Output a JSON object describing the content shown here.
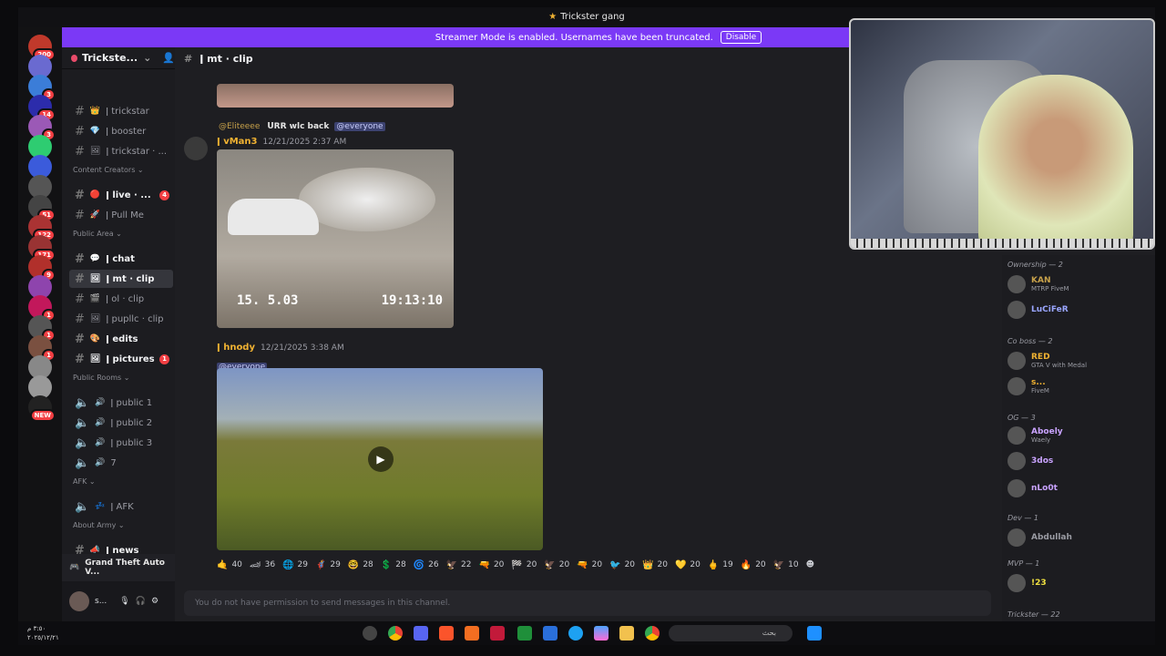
{
  "window": {
    "title": "Trickster gang"
  },
  "banner": {
    "text": "Streamer Mode is enabled. Usernames have been truncated.",
    "button": "Disable"
  },
  "servers": [
    {
      "badge": "200"
    },
    {
      "badge": ""
    },
    {
      "badge": "3"
    },
    {
      "badge": "14"
    },
    {
      "badge": "3"
    },
    {
      "badge": ""
    },
    {
      "badge": ""
    },
    {
      "badge": ""
    },
    {
      "badge": "51"
    },
    {
      "badge": "122"
    },
    {
      "badge": "171"
    },
    {
      "badge": "9"
    },
    {
      "badge": ""
    },
    {
      "badge": "1"
    },
    {
      "badge": "1"
    },
    {
      "badge": "1"
    },
    {
      "badge": ""
    },
    {
      "badge": ""
    },
    {
      "badge": "NEW"
    }
  ],
  "guild": {
    "name": "Trickste..."
  },
  "channels": {
    "items": [
      {
        "label": "ǀ trickstar"
      },
      {
        "label": "ǀ booster"
      },
      {
        "label": "ǀ trickstar · ..."
      },
      {
        "label": "ǀ live · ...",
        "unread": "4"
      },
      {
        "label": "ǀ Pull Me"
      },
      {
        "label": "ǀ chat"
      },
      {
        "label": "ǀ mt · clip"
      },
      {
        "label": "ǀ ol · clip"
      },
      {
        "label": "ǀ pupllc · clip"
      },
      {
        "label": "ǀ edits"
      },
      {
        "label": "ǀ pictures",
        "unread": "1"
      },
      {
        "label": "ǀ public 1"
      },
      {
        "label": "ǀ public 2"
      },
      {
        "label": "ǀ public 3"
      },
      {
        "label": "7"
      },
      {
        "label": "ǀ AFK"
      },
      {
        "label": "ǀ news"
      }
    ],
    "categories": [
      "Content Creators ⌄",
      "Public Area ⌄",
      "Public Rooms ⌄",
      "AFK ⌄",
      "About Army ⌄"
    ]
  },
  "voice": {
    "label": "Grand Theft Auto V..."
  },
  "user": {
    "name": "s..."
  },
  "header": {
    "channel": "ǀ mt · clip"
  },
  "messages": [
    {
      "reply_user": "@Eliteeee",
      "reply_text": "ᑌRR wlc back",
      "reply_mention": "@everyone",
      "author": "ǀ vMan3",
      "time": "12/21/2025 2:37 AM",
      "overlay_a": "15. 5.03",
      "overlay_b": "19:13:10"
    },
    {
      "author": "ǀ hnody",
      "time": "12/21/2025 3:38 AM",
      "mention": "@everyone"
    }
  ],
  "reactions": [
    {
      "icon": "🤙",
      "count": "40"
    },
    {
      "icon": "🏎",
      "count": "36"
    },
    {
      "icon": "🌐",
      "count": "29"
    },
    {
      "icon": "🦸",
      "count": "29"
    },
    {
      "icon": "🤓",
      "count": "28"
    },
    {
      "icon": "💲",
      "count": "28"
    },
    {
      "icon": "🌀",
      "count": "26"
    },
    {
      "icon": "🦅",
      "count": "22"
    },
    {
      "icon": "🔫",
      "count": "20"
    },
    {
      "icon": "🏁",
      "count": "20"
    },
    {
      "icon": "🦅",
      "count": "20"
    },
    {
      "icon": "🔫",
      "count": "20"
    },
    {
      "icon": "🐦",
      "count": "20"
    },
    {
      "icon": "👑",
      "count": "20"
    },
    {
      "icon": "💛",
      "count": "20"
    },
    {
      "icon": "🖕",
      "count": "19"
    },
    {
      "icon": "🔥",
      "count": "20"
    },
    {
      "icon": "🦅",
      "count": "10"
    }
  ],
  "composer": {
    "placeholder": "You do not have permission to send messages in this channel."
  },
  "members": {
    "groups": [
      {
        "label": "Ownership — 2"
      },
      {
        "label": "Co boss — 2"
      },
      {
        "label": "OG — 3"
      },
      {
        "label": "Dev — 1"
      },
      {
        "label": "MVP — 1"
      },
      {
        "label": "Trickster — 22"
      }
    ],
    "items": [
      {
        "name": "KAN",
        "status": "MTRP FiveM",
        "color": "#c7a14a"
      },
      {
        "name": "LuCiFeR",
        "status": "",
        "color": "#9aa6ff"
      },
      {
        "name": "RED",
        "status": "GTA V with Medal",
        "color": "#f0b232"
      },
      {
        "name": "s...",
        "status": "FiveM",
        "color": "#f0b232"
      },
      {
        "name": "Aboely",
        "status": "Waely",
        "color": "#c9a3ff"
      },
      {
        "name": "3dos",
        "status": "",
        "color": "#c9a3ff"
      },
      {
        "name": "nLo0t",
        "status": "",
        "color": "#c9a3ff"
      },
      {
        "name": "Abdullah",
        "status": "",
        "color": "#9a9ba3"
      },
      {
        "name": "!23",
        "status": "",
        "color": "#f0e040"
      }
    ]
  },
  "taskbar": {
    "search": "بحث",
    "time": "٣:٥٠ م",
    "date": "٢٠٢٥/١٢/٢١"
  }
}
